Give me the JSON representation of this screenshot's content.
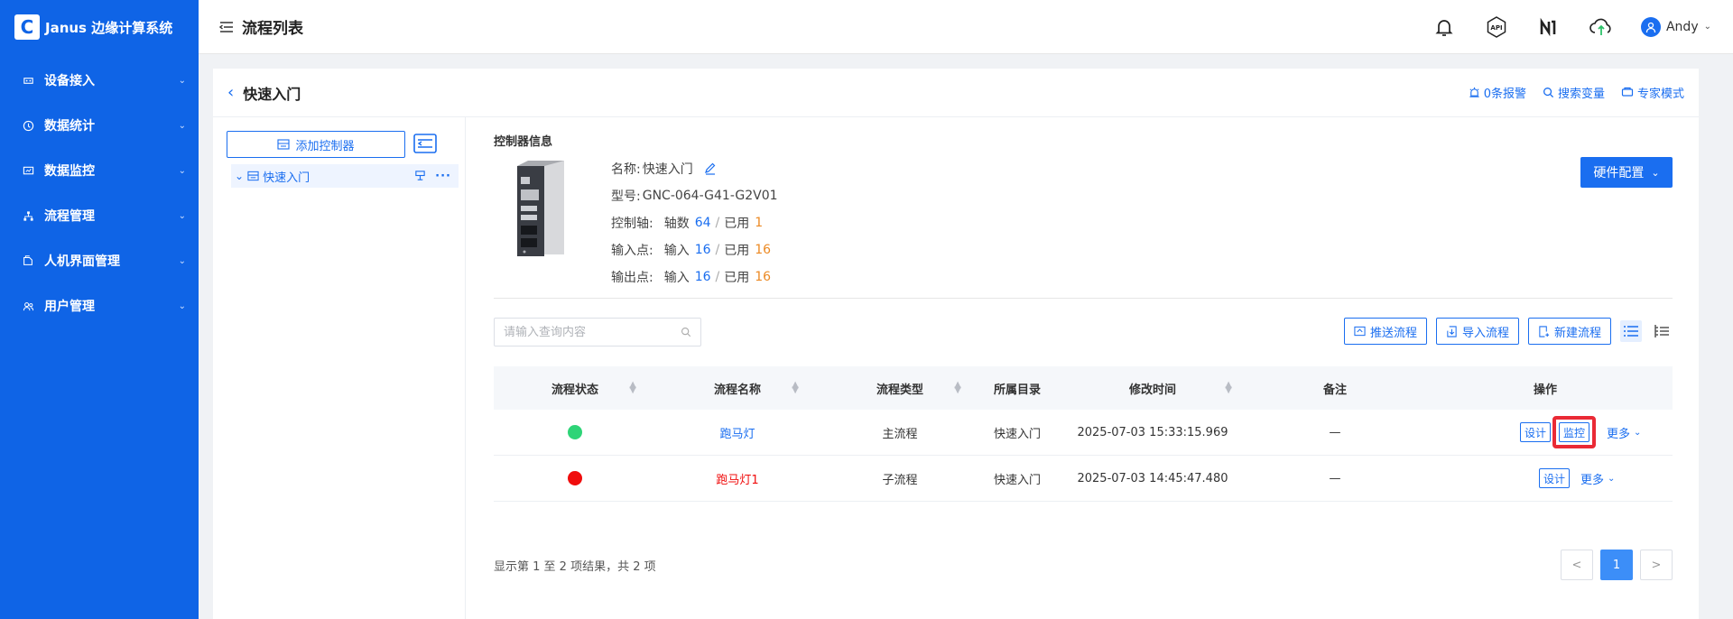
{
  "app": {
    "title": "Janus 边缘计算系统",
    "logo_glyph": "C"
  },
  "sidebar": {
    "items": [
      {
        "label": "设备接入",
        "icon": "device-icon"
      },
      {
        "label": "数据统计",
        "icon": "clock-icon"
      },
      {
        "label": "数据监控",
        "icon": "monitor-icon"
      },
      {
        "label": "流程管理",
        "icon": "flow-icon"
      },
      {
        "label": "人机界面管理",
        "icon": "hmi-icon"
      },
      {
        "label": "用户管理",
        "icon": "users-icon"
      }
    ]
  },
  "header": {
    "title": "流程列表",
    "user": "Andy",
    "icons": [
      "bell-icon",
      "api-icon",
      "brand-icon",
      "cloud-sync-icon"
    ]
  },
  "topbar": {
    "title": "快速入门",
    "links": [
      {
        "label": "0条报警",
        "icon": "alarm-icon"
      },
      {
        "label": "搜索变量",
        "icon": "search-icon"
      },
      {
        "label": "专家模式",
        "icon": "expert-icon"
      }
    ]
  },
  "left_panel": {
    "add_label": "添加控制器",
    "tree": [
      {
        "label": "快速入门"
      }
    ]
  },
  "controller": {
    "section_title": "控制器信息",
    "name_label": "名称:",
    "name": "快速入门",
    "model_label": "型号:",
    "model": "GNC-064-G41-G2V01",
    "axis_label": "控制轴:",
    "axis_count_label": "轴数",
    "axis_total": "64",
    "used_label": "已用",
    "axis_used": "1",
    "input_label": "输入点:",
    "input_count_label": "输入",
    "input_total": "16",
    "input_used": "16",
    "output_label": "输出点:",
    "output_count_label": "输入",
    "output_total": "16",
    "output_used": "16",
    "hw_button": "硬件配置"
  },
  "toolbar": {
    "search_placeholder": "请输入查询内容",
    "push_label": "推送流程",
    "import_label": "导入流程",
    "new_label": "新建流程"
  },
  "table": {
    "headers": [
      "流程状态",
      "流程名称",
      "流程类型",
      "所属目录",
      "修改时间",
      "备注",
      "操作"
    ],
    "rows": [
      {
        "status_color": "#2ed477",
        "name": "跑马灯",
        "name_color": "#1a6ef0",
        "type": "主流程",
        "dir": "快速入门",
        "time": "2025-07-03 15:33:15.969",
        "note": "—",
        "design": "设计",
        "monitor": "监控",
        "more": "更多"
      },
      {
        "status_color": "#f00d0d",
        "name": "跑马灯1",
        "name_color": "#f00d0d",
        "type": "子流程",
        "dir": "快速入门",
        "time": "2025-07-03 14:45:47.480",
        "note": "—",
        "design": "设计",
        "more": "更多"
      }
    ]
  },
  "pagination": {
    "info": "显示第 1 至 2 项结果，共 2 项",
    "prev": "<",
    "current": "1",
    "next": ">"
  }
}
